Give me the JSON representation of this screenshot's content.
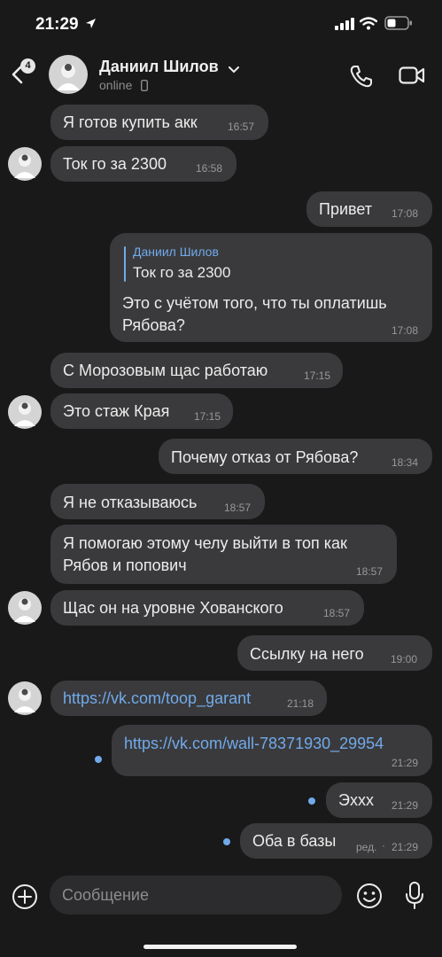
{
  "status_bar": {
    "time": "21:29"
  },
  "header": {
    "unread_count": "4",
    "contact_name": "Даниил Шилов",
    "status": "online"
  },
  "messages": [
    {
      "dir": "in",
      "text": "Я готов купить акк",
      "time": "16:57"
    },
    {
      "dir": "in",
      "text": "Ток го за 2300",
      "time": "16:58"
    },
    {
      "dir": "out",
      "text": "Привет",
      "time": "17:08"
    },
    {
      "dir": "out",
      "reply_to": {
        "author": "Даниил Шилов",
        "text": "Ток го за 2300"
      },
      "text_lines": [
        "Это с учётом того, что ты оплатишь",
        "Рябова?"
      ],
      "time": "17:08"
    },
    {
      "dir": "in",
      "text": "С Морозовым щас работаю",
      "time": "17:15"
    },
    {
      "dir": "in",
      "text": "Это стаж Края",
      "time": "17:15"
    },
    {
      "dir": "out",
      "text": "Почему отказ от Рябова?",
      "time": "18:34"
    },
    {
      "dir": "in",
      "text": "Я не отказываюсь",
      "time": "18:57"
    },
    {
      "dir": "in",
      "text_lines": [
        "Я помогаю этому челу выйти в топ как",
        "Рябов и попович"
      ],
      "time": "18:57"
    },
    {
      "dir": "in",
      "text": "Щас он на уровне Хованского",
      "time": "18:57"
    },
    {
      "dir": "out",
      "text": "Ссылку на него",
      "time": "19:00"
    },
    {
      "dir": "in",
      "text": "https://vk.com/toop_garant",
      "time": "21:18",
      "is_link": true
    },
    {
      "dir": "out",
      "text": "https://vk.com/wall-78371930_29954",
      "time": "21:29",
      "is_link": true,
      "unread": true
    },
    {
      "dir": "out",
      "text": "Эххх",
      "time": "21:29",
      "unread": true
    },
    {
      "dir": "out",
      "text": "Оба в базы",
      "edited": "ред.",
      "time": "21:29",
      "unread": true
    }
  ],
  "composer": {
    "placeholder": "Сообщение"
  },
  "colors": {
    "background": "#19191a",
    "bubble": "#3a3a3c",
    "accent": "#71aaeb",
    "secondary_text": "#98989b"
  }
}
